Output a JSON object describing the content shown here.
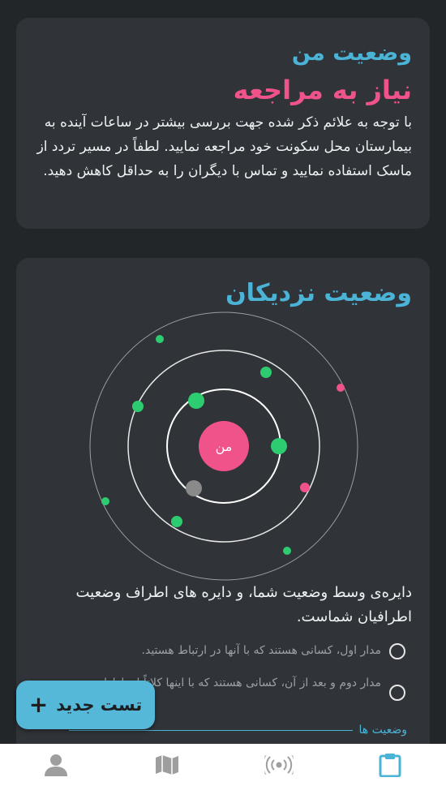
{
  "my_status": {
    "title": "وضعیت من",
    "value": "نیاز به مراجعه",
    "description": "با توجه به علائم ذکر شده جهت بررسی بیشتر در ساعات آینده به بیمارستان محل سکونت خود مراجعه نمایید. لطفاً در مسیر تردد از ماسک استفاده نمایید و تماس با دیگران را به حداقل کاهش دهید."
  },
  "nearby": {
    "title": "وضعیت نزدیکان",
    "center_label": "من",
    "explanation": "دایره‌ی وسط وضعیت شما، و دایره های اطراف وضعیت اطرافیان شماست.",
    "legend": [
      {
        "text": "مدار اول، کسانی هستند که با آنها در ارتباط هستید."
      },
      {
        "text": "مدار دوم و بعد از آن، کسانی هستند که با اینها کلاتاً ارتباط اند."
      }
    ],
    "tab_label": "وضعیت ها"
  },
  "fab": {
    "label": "تست جدید",
    "plus": "+"
  },
  "colors": {
    "accent": "#4ab3d6",
    "alert": "#f0528a",
    "green": "#2ecc71",
    "gray": "#8a8a8a",
    "nav_active": "#4ab3d6",
    "nav_inactive": "#9e9e9e"
  },
  "bottom_nav": [
    "profile-icon",
    "map-icon",
    "broadcast-icon",
    "clipboard-icon"
  ]
}
